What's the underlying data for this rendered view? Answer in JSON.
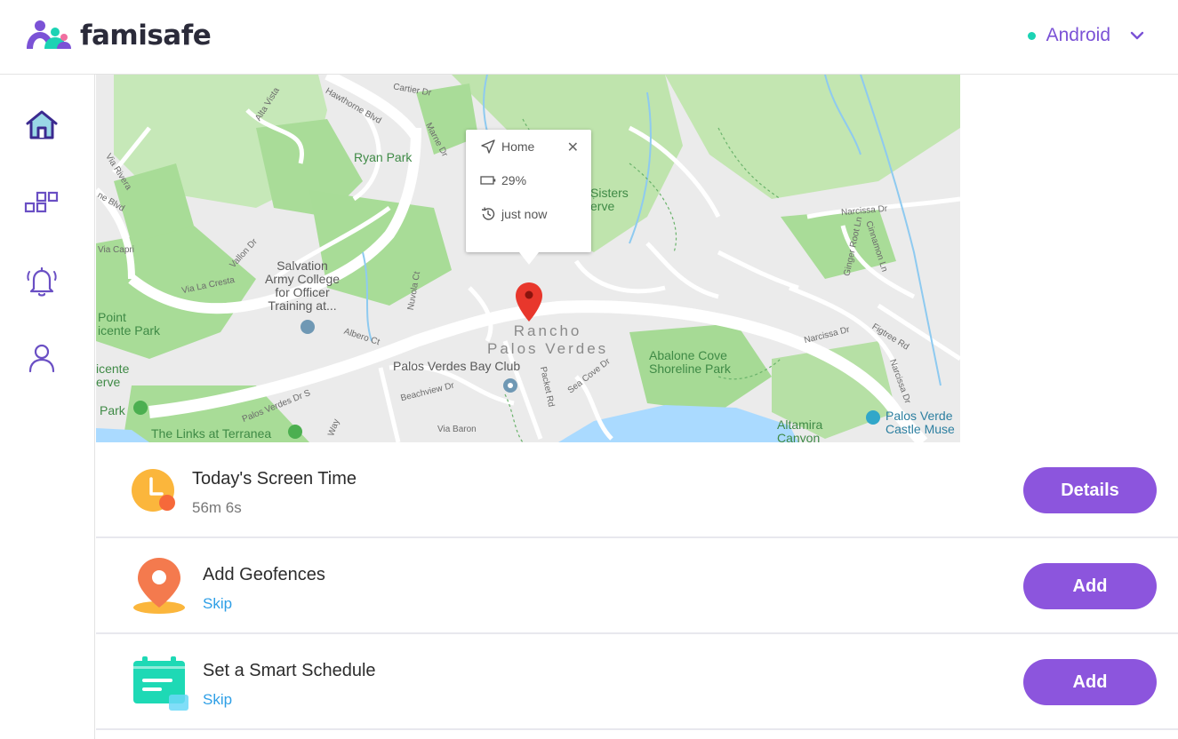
{
  "app": {
    "logo_text": "famisafe",
    "device_name": "Android",
    "device_status_color": "#1bd3b4",
    "accent_color": "#8c55dd"
  },
  "sidebar": {
    "items": [
      {
        "icon": "home-icon"
      },
      {
        "icon": "features-grid-icon"
      },
      {
        "icon": "bell-icon"
      },
      {
        "icon": "account-icon"
      }
    ]
  },
  "map": {
    "popup": {
      "location": "Home",
      "battery": "29%",
      "time": "just now"
    },
    "labels": {
      "ryan_park": "Ryan Park",
      "salvation_army": "Salvation\nArmy College\nfor Officer\nTraining at...",
      "point_vicente": "Point\nicente Park",
      "vicente_reserve": "icente\nerve",
      "park": "Park",
      "links": "The Links at Terranea",
      "city": "Rancho\nPalos Verdes",
      "bay_club": "Palos Verdes Bay Club",
      "abalone": "Abalone Cove\nShoreline Park",
      "altamira": "Altamira\nCanyon",
      "castle": "Palos Verde\nCastle Muse",
      "sisters": "Sisters\nerve",
      "hawthorne": "Hawthorne Blvd",
      "palos_verdes_dr": "Palos Verdes Dr S",
      "via_la_cresta": "Via La Cresta",
      "narcissa": "Narcissa Dr",
      "cartier": "Cartier Dr",
      "via_capri": "Via Capri",
      "beachview": "Beachview Dr",
      "via_baron": "Via Baron",
      "sea_cove": "Sea Cove Dr",
      "packet": "Packet Rd",
      "figtree": "Figtree Rd",
      "ginger_root": "Ginger Root Ln",
      "cinnamon": "Cinnamon Ln",
      "altalta": "Alta Vista",
      "marne": "Marne Dr",
      "vallon": "Vallon Dr",
      "nuvola": "Nuvola Ct",
      "albero": "Albero Ct",
      "via_rivera": "Via Rivera",
      "ne_blvd": "ne Blvd",
      "narcissa2": "Narcissa Dr",
      "narcissa3": "Narcissa Dr",
      "way": "Way"
    }
  },
  "cards": [
    {
      "title": "Today's Screen Time",
      "subtitle": "56m 6s",
      "button": "Details",
      "icon": "clock-icon"
    },
    {
      "title": "Add Geofences",
      "link": "Skip",
      "button": "Add",
      "icon": "geofence-pin-icon"
    },
    {
      "title": "Set a Smart Schedule",
      "link": "Skip",
      "button": "Add",
      "icon": "calendar-schedule-icon"
    }
  ]
}
